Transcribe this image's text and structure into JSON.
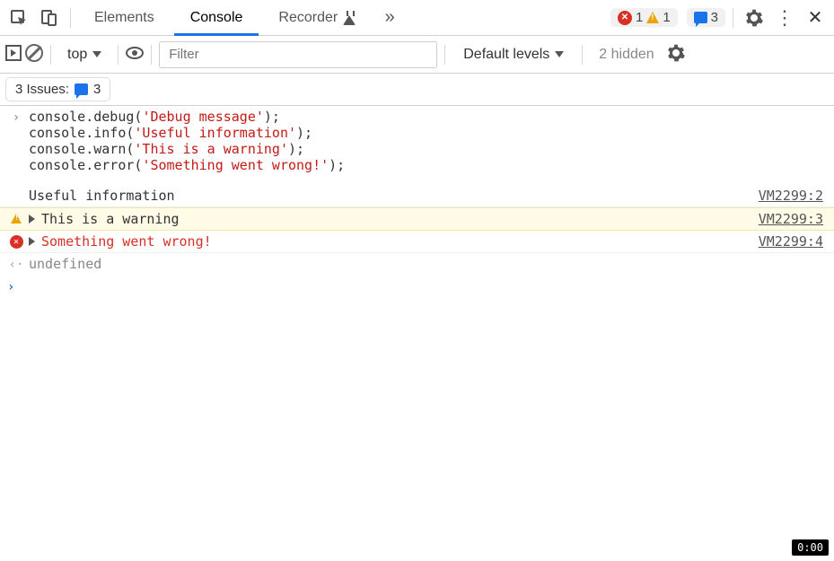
{
  "tabs": {
    "elements": "Elements",
    "console": "Console",
    "recorder": "Recorder"
  },
  "counters": {
    "errors": "1",
    "warnings": "1",
    "info": "3"
  },
  "toolbar": {
    "context": "top",
    "filter_placeholder": "Filter",
    "levels": "Default levels",
    "hidden": "2 hidden"
  },
  "issues": {
    "label": "3 Issues:",
    "count": "3"
  },
  "code": {
    "l1a": "console.debug(",
    "l1s": "'Debug message'",
    "l1b": ");",
    "l2a": "console.info(",
    "l2s": "'Useful information'",
    "l2b": ");",
    "l3a": "console.warn(",
    "l3s": "'This is a warning'",
    "l3b": ");",
    "l4a": "console.error(",
    "l4s": "'Something went wrong!'",
    "l4b": ");"
  },
  "out": {
    "info_msg": "Useful information",
    "info_src": "VM2299:2",
    "warn_msg": "This is a warning",
    "warn_src": "VM2299:3",
    "err_msg": "Something went wrong!",
    "err_src": "VM2299:4",
    "ret": "undefined"
  },
  "timer": "0:00"
}
